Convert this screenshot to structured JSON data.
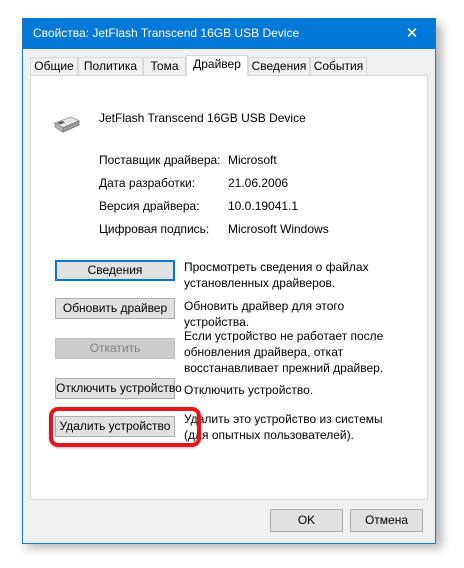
{
  "window": {
    "title": "Свойства: JetFlash Transcend 16GB USB Device",
    "close_glyph": "✕"
  },
  "tabs": [
    {
      "label": "Общие"
    },
    {
      "label": "Политика"
    },
    {
      "label": "Тома"
    },
    {
      "label": "Драйвер",
      "active": true
    },
    {
      "label": "Сведения"
    },
    {
      "label": "События"
    }
  ],
  "device": {
    "icon": "usb-drive-icon",
    "name": "JetFlash Transcend 16GB USB Device"
  },
  "properties": [
    {
      "label": "Поставщик драйвера:",
      "value": "Microsoft"
    },
    {
      "label": "Дата разработки:",
      "value": "21.06.2006"
    },
    {
      "label": "Версия драйвера:",
      "value": "10.0.19041.1"
    },
    {
      "label": "Цифровая подпись:",
      "value": "Microsoft Windows"
    }
  ],
  "actions": [
    {
      "button": "Сведения",
      "description": "Просмотреть сведения о файлах установленных драйверов."
    },
    {
      "button": "Обновить драйвер",
      "description": "Обновить драйвер для этого устройства."
    },
    {
      "button": "Откатить",
      "description": "Если устройство не работает после обновления драйвера, откат восстанавливает прежний драйвер.",
      "disabled": true
    },
    {
      "button": "Отключить устройство",
      "description": "Отключить устройство."
    },
    {
      "button": "Удалить устройство",
      "description": "Удалить это устройство из системы (для опытных пользователей).",
      "highlighted": true
    }
  ],
  "footer": {
    "ok_label": "OK",
    "cancel_label": "Отмена"
  },
  "colors": {
    "titlebar": "#0078d7",
    "highlight": "#e8141c",
    "focus": "#0078d7"
  }
}
